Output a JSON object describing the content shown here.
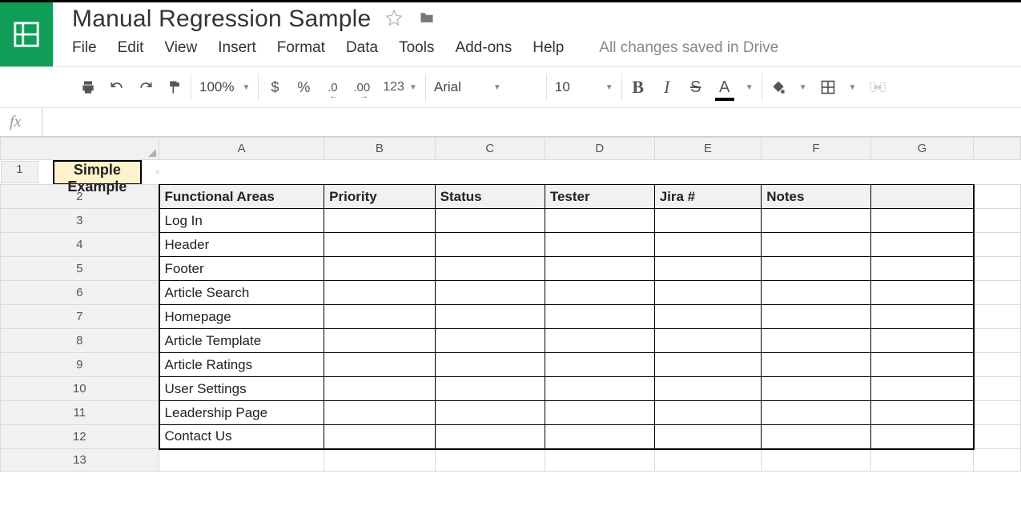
{
  "doc": {
    "title": "Manual Regression Sample"
  },
  "menus": {
    "file": "File",
    "edit": "Edit",
    "view": "View",
    "insert": "Insert",
    "format": "Format",
    "data": "Data",
    "tools": "Tools",
    "addons": "Add-ons",
    "help": "Help"
  },
  "status": {
    "saved": "All changes saved in Drive"
  },
  "toolbar": {
    "zoom": "100%",
    "currency": "$",
    "percent": "%",
    "dec_less": ".0",
    "dec_more": ".00",
    "num_format": "123",
    "font_name": "Arial",
    "font_size": "10",
    "bold": "B",
    "italic": "I",
    "strike": "S",
    "textcolor": "A"
  },
  "formula": {
    "label": "fx",
    "value": ""
  },
  "columns": [
    "A",
    "B",
    "C",
    "D",
    "E",
    "F",
    "G"
  ],
  "row_numbers": [
    "1",
    "2",
    "3",
    "4",
    "5",
    "6",
    "7",
    "8",
    "9",
    "10",
    "11",
    "12",
    "13"
  ],
  "sheet": {
    "title_merged": "Simple Example",
    "headers": [
      "Functional Areas",
      "Priority",
      "Status",
      "Tester",
      "Jira #",
      "Notes"
    ],
    "rows": [
      {
        "area": "Log In",
        "priority": "",
        "status": "",
        "tester": "",
        "jira": "",
        "notes": ""
      },
      {
        "area": "Header",
        "priority": "",
        "status": "",
        "tester": "",
        "jira": "",
        "notes": ""
      },
      {
        "area": "Footer",
        "priority": "",
        "status": "",
        "tester": "",
        "jira": "",
        "notes": ""
      },
      {
        "area": "Article Search",
        "priority": "",
        "status": "",
        "tester": "",
        "jira": "",
        "notes": ""
      },
      {
        "area": "Homepage",
        "priority": "",
        "status": "",
        "tester": "",
        "jira": "",
        "notes": ""
      },
      {
        "area": "Article Template",
        "priority": "",
        "status": "",
        "tester": "",
        "jira": "",
        "notes": ""
      },
      {
        "area": "Article Ratings",
        "priority": "",
        "status": "",
        "tester": "",
        "jira": "",
        "notes": ""
      },
      {
        "area": "User Settings",
        "priority": "",
        "status": "",
        "tester": "",
        "jira": "",
        "notes": ""
      },
      {
        "area": "Leadership Page",
        "priority": "",
        "status": "",
        "tester": "",
        "jira": "",
        "notes": ""
      },
      {
        "area": "Contact Us",
        "priority": "",
        "status": "",
        "tester": "",
        "jira": "",
        "notes": ""
      }
    ]
  }
}
